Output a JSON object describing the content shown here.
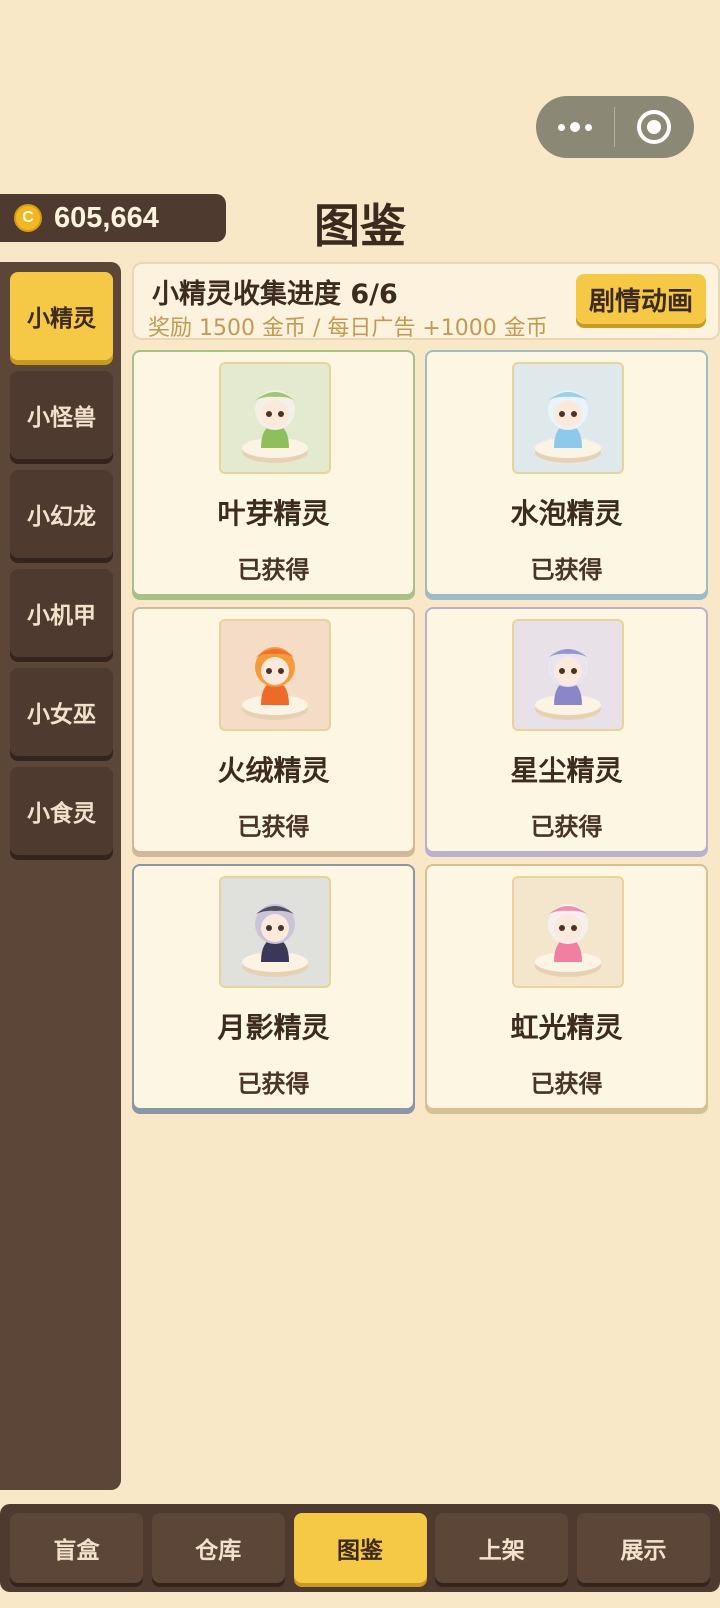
{
  "header": {
    "coins": "605,664",
    "coin_icon_symbol": "C",
    "page_title": "图鉴"
  },
  "sidebar": {
    "items": [
      {
        "label": "小精灵",
        "active": true
      },
      {
        "label": "小怪兽",
        "active": false
      },
      {
        "label": "小幻龙",
        "active": false
      },
      {
        "label": "小机甲",
        "active": false
      },
      {
        "label": "小女巫",
        "active": false
      },
      {
        "label": "小食灵",
        "active": false
      }
    ]
  },
  "banner": {
    "title": "小精灵收集进度 6/6",
    "subtitle": "奖励 1500 金币 / 每日广告 +1000 金币",
    "button_label": "剧情动画"
  },
  "cards": [
    {
      "name": "叶芽精灵",
      "status": "已获得",
      "icon": "leaf-sprite-figure-icon",
      "art_bg": "#e4ead0",
      "accent": "#8fbf5a",
      "hair": "#f3f0e8",
      "border": "#a9c089"
    },
    {
      "name": "水泡精灵",
      "status": "已获得",
      "icon": "bubble-sprite-figure-icon",
      "art_bg": "#dfe8ea",
      "accent": "#8cc9ea",
      "hair": "#e8f3fa",
      "border": "#9fbcc6"
    },
    {
      "name": "火绒精灵",
      "status": "已获得",
      "icon": "fire-sprite-figure-icon",
      "art_bg": "#f4dcc6",
      "accent": "#ee6a28",
      "hair": "#f59b3c",
      "border": "#d1b89a"
    },
    {
      "name": "星尘精灵",
      "status": "已获得",
      "icon": "stardust-sprite-figure-icon",
      "art_bg": "#e8e2e8",
      "accent": "#8a86c8",
      "hair": "#e9e4f2",
      "border": "#bcb0cf"
    },
    {
      "name": "月影精灵",
      "status": "已获得",
      "icon": "moon-shadow-sprite-figure-icon",
      "art_bg": "#e0e0dc",
      "accent": "#3a3858",
      "hair": "#c9c4d8",
      "border": "#8b96a6"
    },
    {
      "name": "虹光精灵",
      "status": "已获得",
      "icon": "rainbow-sprite-figure-icon",
      "art_bg": "#f4e6cc",
      "accent": "#f07fa2",
      "hair": "#f5f0f0",
      "border": "#d8bf94"
    }
  ],
  "bottom_nav": {
    "items": [
      {
        "label": "盲盒",
        "active": false
      },
      {
        "label": "仓库",
        "active": false
      },
      {
        "label": "图鉴",
        "active": true
      },
      {
        "label": "上架",
        "active": false
      },
      {
        "label": "展示",
        "active": false
      }
    ]
  },
  "colors": {
    "background": "#f8e8c8",
    "panel_dark": "#4e3a2e",
    "active_yellow": "#f5c845"
  }
}
